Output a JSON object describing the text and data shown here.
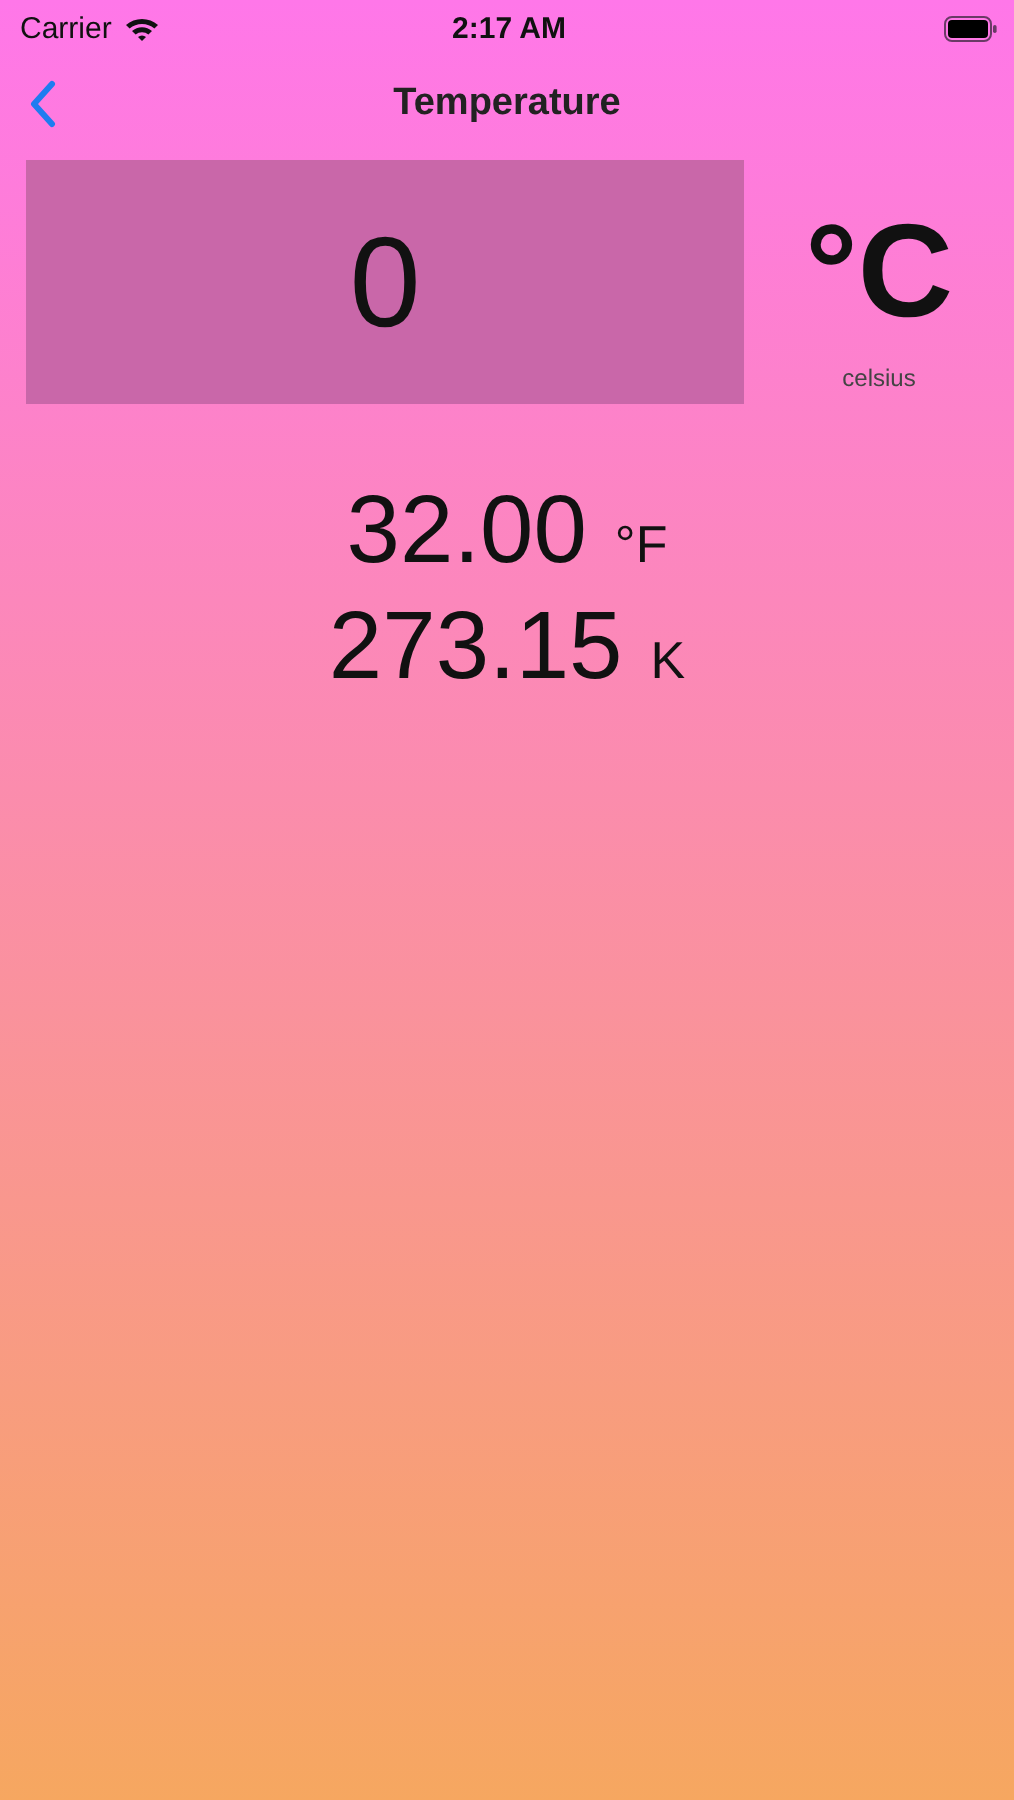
{
  "status_bar": {
    "carrier": "Carrier",
    "time": "2:17 AM"
  },
  "nav": {
    "title": "Temperature"
  },
  "input": {
    "value": "0",
    "unit": "°C",
    "unit_name": "celsius"
  },
  "results": [
    {
      "value": "32.00",
      "unit": "°F"
    },
    {
      "value": "273.15",
      "unit": "K"
    }
  ]
}
